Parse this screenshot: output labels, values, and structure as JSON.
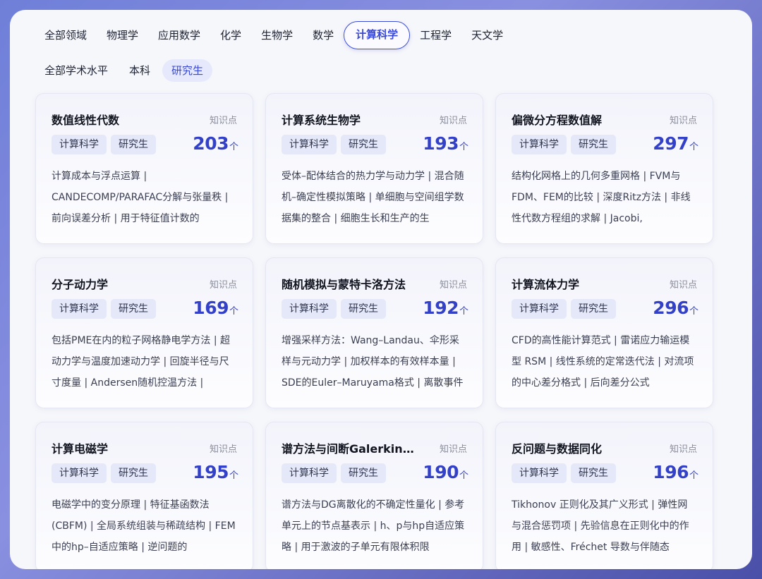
{
  "fields": [
    "全部领域",
    "物理学",
    "应用数学",
    "化学",
    "生物学",
    "数学",
    "计算科学",
    "工程学",
    "天文学"
  ],
  "active_field": "计算科学",
  "levels": [
    "全部学术水平",
    "本科",
    "研究生"
  ],
  "active_level": "研究生",
  "knowledge_label": "知识点",
  "unit": "个",
  "cards": [
    {
      "title": "数值线性代数",
      "tags": [
        "计算科学",
        "研究生"
      ],
      "count": "203",
      "desc": "计算成本与浮点运算 | CANDECOMP/PARAFAC分解与张量秩 | 前向误差分析 | 用于特征值计数的"
    },
    {
      "title": "计算系统生物学",
      "tags": [
        "计算科学",
        "研究生"
      ],
      "count": "193",
      "desc": "受体–配体结合的热力学与动力学 | 混合随机–确定性模拟策略 | 单细胞与空间组学数据集的整合 | 细胞生长和生产的生"
    },
    {
      "title": "偏微分方程数值解",
      "tags": [
        "计算科学",
        "研究生"
      ],
      "count": "297",
      "desc": "结构化网格上的几何多重网格 | FVM与FDM、FEM的比较 | 深度Ritz方法 | 非线性代数方程组的求解 | Jacobi,"
    },
    {
      "title": "分子动力学",
      "tags": [
        "计算科学",
        "研究生"
      ],
      "count": "169",
      "desc": "包括PME在内的粒子网格静电学方法 | 超动力学与温度加速动力学 | 回旋半径与尺寸度量 | Andersen随机控温方法 |"
    },
    {
      "title": "随机模拟与蒙特卡洛方法",
      "tags": [
        "计算科学",
        "研究生"
      ],
      "count": "192",
      "desc": "增强采样方法：Wang–Landau、伞形采样与元动力学 | 加权样本的有效样本量 | SDE的Euler–Maruyama格式 | 离散事件"
    },
    {
      "title": "计算流体力学",
      "tags": [
        "计算科学",
        "研究生"
      ],
      "count": "296",
      "desc": "CFD的高性能计算范式 | 雷诺应力输运模型 RSM | 线性系统的定常迭代法 | 对流项的中心差分格式 | 后向差分公式"
    },
    {
      "title": "计算电磁学",
      "tags": [
        "计算科学",
        "研究生"
      ],
      "count": "195",
      "desc": "电磁学中的变分原理 | 特征基函数法 (CBFM) | 全局系统组装与稀疏结构 | FEM中的hp–自适应策略 | 逆问题的"
    },
    {
      "title": "谱方法与间断Galerkin方法",
      "tags": [
        "计算科学",
        "研究生"
      ],
      "count": "190",
      "desc": "谱方法与DG离散化的不确定性量化 | 参考单元上的节点基表示 | h、p与hp自适应策略 | 用于激波的子单元有限体积限"
    },
    {
      "title": "反问题与数据同化",
      "tags": [
        "计算科学",
        "研究生"
      ],
      "count": "196",
      "desc": "Tikhonov 正则化及其广义形式 | 弹性网与混合惩罚项 | 先验信息在正则化中的作用 | 敏感性、Fréchet 导数与伴随态"
    }
  ]
}
